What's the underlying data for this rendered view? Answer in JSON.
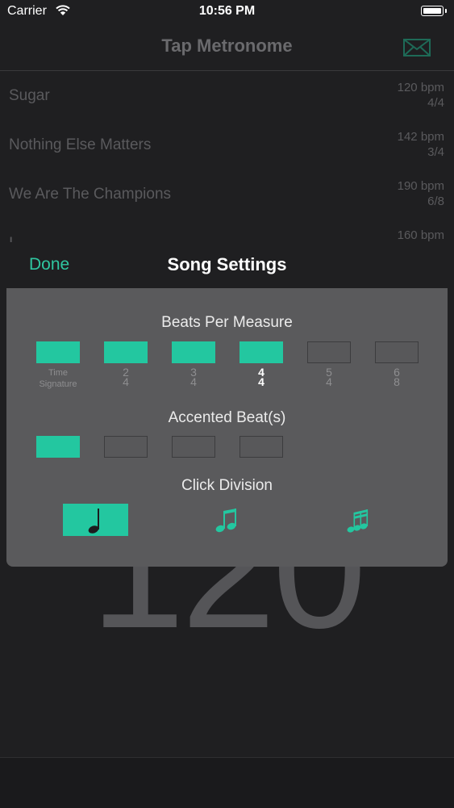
{
  "status_bar": {
    "carrier": "Carrier",
    "time": "10:56 PM"
  },
  "nav": {
    "title": "Tap Metronome"
  },
  "songs": [
    {
      "name": "Sugar",
      "bpm": "120 bpm",
      "sig": "4/4"
    },
    {
      "name": "Nothing Else Matters",
      "bpm": "142 bpm",
      "sig": "3/4"
    },
    {
      "name": "We Are The Champions",
      "bpm": "190 bpm",
      "sig": "6/8"
    },
    {
      "name": "I",
      "bpm": "160 bpm",
      "sig": ""
    }
  ],
  "big_tempo": "120",
  "settings": {
    "done_label": "Done",
    "title": "Song Settings",
    "beats_label": "Beats Per Measure",
    "time_signature_label": [
      "Time",
      "Signature"
    ],
    "beats": [
      {
        "top": "2",
        "bottom": "4",
        "on": true,
        "selected": false
      },
      {
        "top": "3",
        "bottom": "4",
        "on": true,
        "selected": false
      },
      {
        "top": "4",
        "bottom": "4",
        "on": true,
        "selected": true
      },
      {
        "top": "5",
        "bottom": "4",
        "on": false,
        "selected": false
      },
      {
        "top": "6",
        "bottom": "8",
        "on": false,
        "selected": false
      }
    ],
    "accent_label": "Accented Beat(s)",
    "accents": [
      true,
      false,
      false,
      false
    ],
    "click_label": "Click Division",
    "divisions": [
      {
        "icon": "quarter-note-icon",
        "on": true
      },
      {
        "icon": "eighth-notes-icon",
        "on": false
      },
      {
        "icon": "sixteenth-notes-icon",
        "on": false
      }
    ]
  },
  "colors": {
    "accent": "#23c7a0",
    "panel": "#5a5a5c",
    "background": "#1f1f21"
  }
}
